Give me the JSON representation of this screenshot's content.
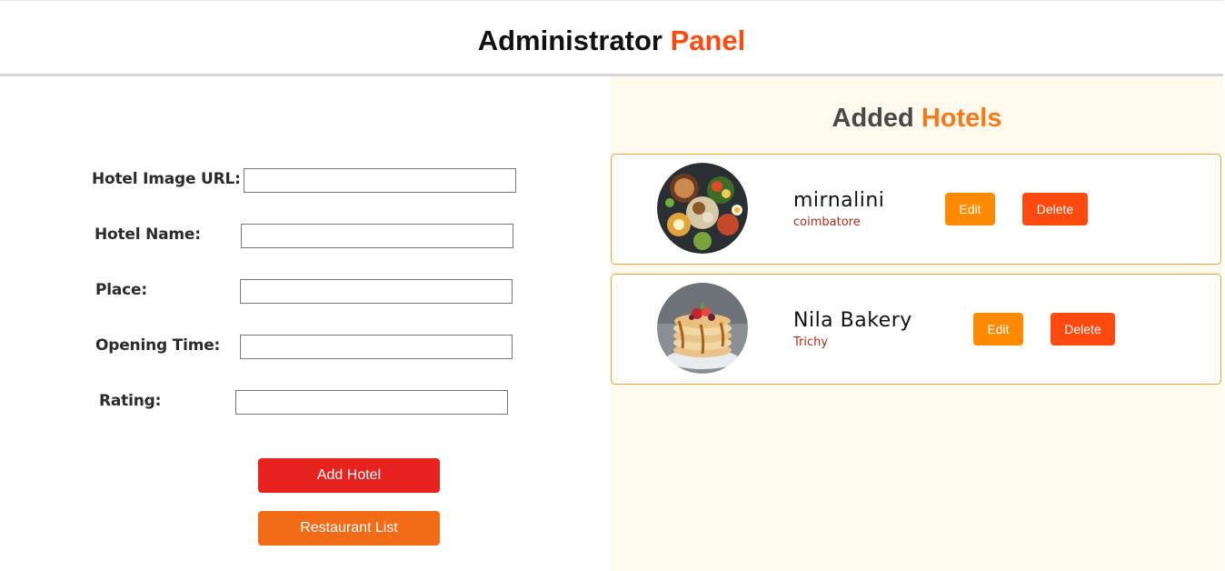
{
  "header": {
    "title_main": "Administrator",
    "title_accent": "Panel"
  },
  "form": {
    "image_url_label": "Hotel Image URL:",
    "image_url_value": "",
    "name_label": "Hotel Name:",
    "name_value": "",
    "place_label": "Place:",
    "place_value": "",
    "opening_time_label": "Opening Time:",
    "opening_time_value": "",
    "rating_label": "Rating:",
    "rating_value": "",
    "add_button_label": "Add Hotel",
    "list_button_label": "Restaurant List"
  },
  "hotels_section": {
    "title_main": "Added",
    "title_accent": "Hotels"
  },
  "hotels": [
    {
      "name": "mirnalini",
      "place": "coimbatore",
      "image_icon": "food-bowl-image",
      "edit_label": "Edit",
      "delete_label": "Delete"
    },
    {
      "name": "Nila Bakery",
      "place": "Trichy",
      "image_icon": "pancake-stack-image",
      "edit_label": "Edit",
      "delete_label": "Delete"
    }
  ],
  "colors": {
    "accent_red": "#ff4a0f",
    "accent_orange": "#f57a17",
    "add_button": "#e8231f",
    "list_button": "#f26b17",
    "edit_button": "#ff8a00",
    "delete_button": "#ff4a0f",
    "right_pane_bg": "#fff9ee",
    "card_border": "#f2a23a"
  }
}
